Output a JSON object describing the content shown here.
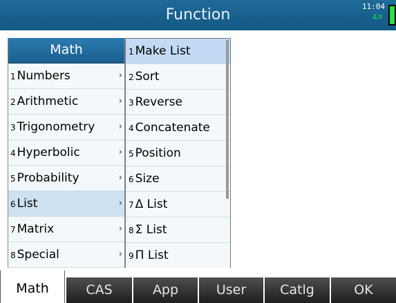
{
  "title": "Function",
  "status": {
    "time": "11:04",
    "angle_mode": "∡π"
  },
  "menu": {
    "header": "Math",
    "items": [
      {
        "num": "1",
        "label": "Numbers"
      },
      {
        "num": "2",
        "label": "Arithmetic"
      },
      {
        "num": "3",
        "label": "Trigonometry"
      },
      {
        "num": "4",
        "label": "Hyperbolic"
      },
      {
        "num": "5",
        "label": "Probability"
      },
      {
        "num": "6",
        "label": "List"
      },
      {
        "num": "7",
        "label": "Matrix"
      },
      {
        "num": "8",
        "label": "Special"
      }
    ],
    "arrow": "›"
  },
  "submenu": {
    "items": [
      {
        "num": "1",
        "label": "Make List"
      },
      {
        "num": "2",
        "label": "Sort"
      },
      {
        "num": "3",
        "label": "Reverse"
      },
      {
        "num": "4",
        "label": "Concatenate"
      },
      {
        "num": "5",
        "label": "Position"
      },
      {
        "num": "6",
        "label": "Size"
      },
      {
        "num": "7",
        "label": "Δ List"
      },
      {
        "num": "8",
        "label": "Σ List"
      },
      {
        "num": "9",
        "label": "Π List"
      }
    ]
  },
  "softkeys": [
    "Math",
    "CAS",
    "App",
    "User",
    "Catlg",
    "OK"
  ],
  "colors": {
    "title_bar": "#1a6291",
    "menu_header": "#2270a3",
    "selected_item": "#cde1f1",
    "battery": "#2adf4a",
    "angle_mode": "#22dd44",
    "softkey_bg": "#333333"
  }
}
